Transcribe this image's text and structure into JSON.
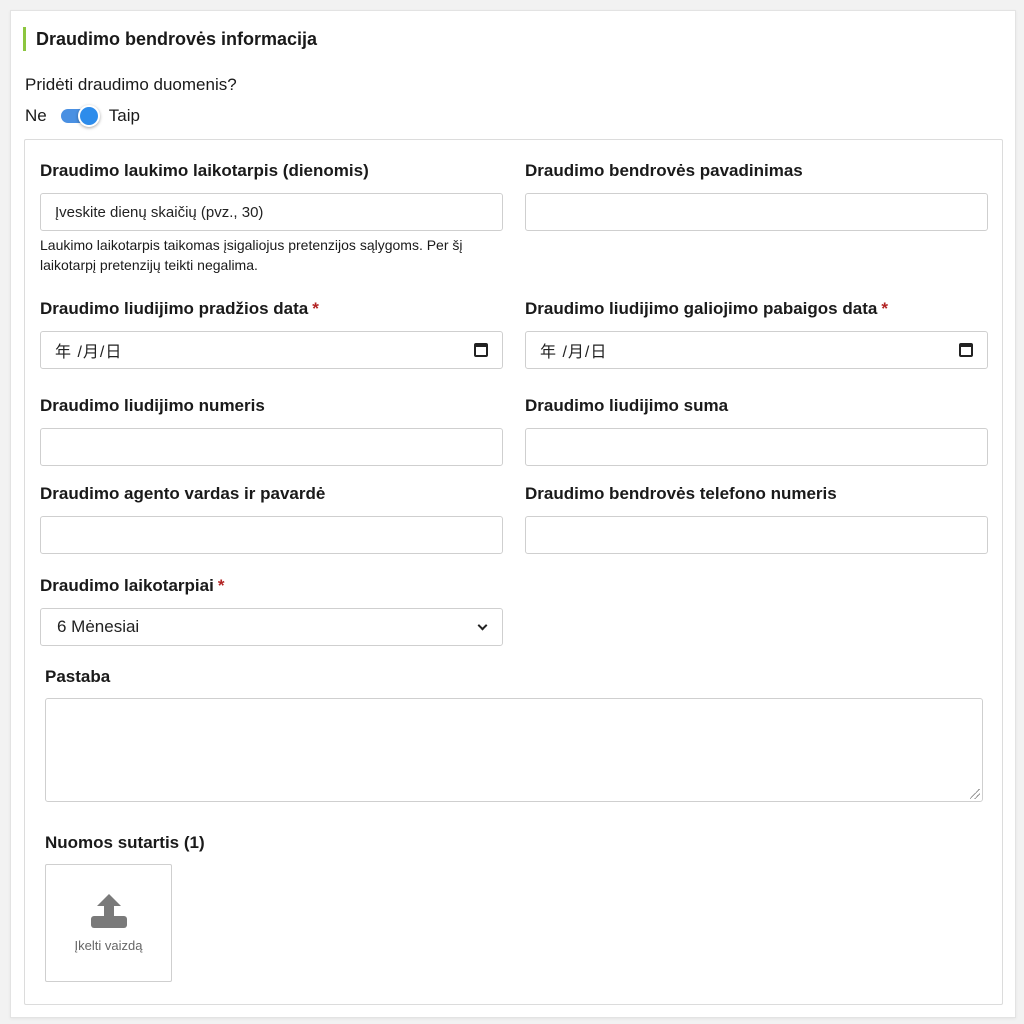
{
  "section": {
    "title": "Draudimo bendrovės informacija"
  },
  "toggle": {
    "question": "Pridėti draudimo duomenis?",
    "off_label": "Ne",
    "on_label": "Taip",
    "state": "on"
  },
  "fields": {
    "waiting_period": {
      "label": "Draudimo laukimo laikotarpis (dienomis)",
      "placeholder": "Įveskite dienų skaičių (pvz., 30)",
      "hint": "Laukimo laikotarpis taikomas įsigaliojus pretenzijos sąlygoms. Per šį laikotarpį pretenzijų teikti negalima."
    },
    "company_name": {
      "label": "Draudimo bendrovės pavadinimas",
      "value": ""
    },
    "start_date": {
      "label": "Draudimo liudijimo pradžios data",
      "required_mark": "*",
      "display": "年 /月/日"
    },
    "end_date": {
      "label": "Draudimo liudijimo galiojimo pabaigos data",
      "required_mark": "*",
      "display": "年 /月/日"
    },
    "certificate_number": {
      "label": "Draudimo liudijimo numeris",
      "value": ""
    },
    "certificate_amount": {
      "label": "Draudimo liudijimo suma",
      "value": ""
    },
    "agent_name": {
      "label": "Draudimo agento vardas ir pavardė",
      "value": ""
    },
    "company_phone": {
      "label": "Draudimo bendrovės telefono numeris",
      "value": ""
    },
    "periods": {
      "label": "Draudimo laikotarpiai",
      "required_mark": "*",
      "selected": "6 Mėnesiai"
    },
    "note": {
      "label": "Pastaba",
      "value": ""
    },
    "lease": {
      "label": "Nuomos sutartis (1)",
      "upload_label": "Įkelti vaizdą"
    }
  },
  "colors": {
    "accent": "#8cc63f",
    "toggle": "#2d8ceb",
    "required": "#b22222"
  },
  "icons": {
    "date": "calendar-icon",
    "select": "chevron-down-icon",
    "upload": "upload-icon"
  }
}
